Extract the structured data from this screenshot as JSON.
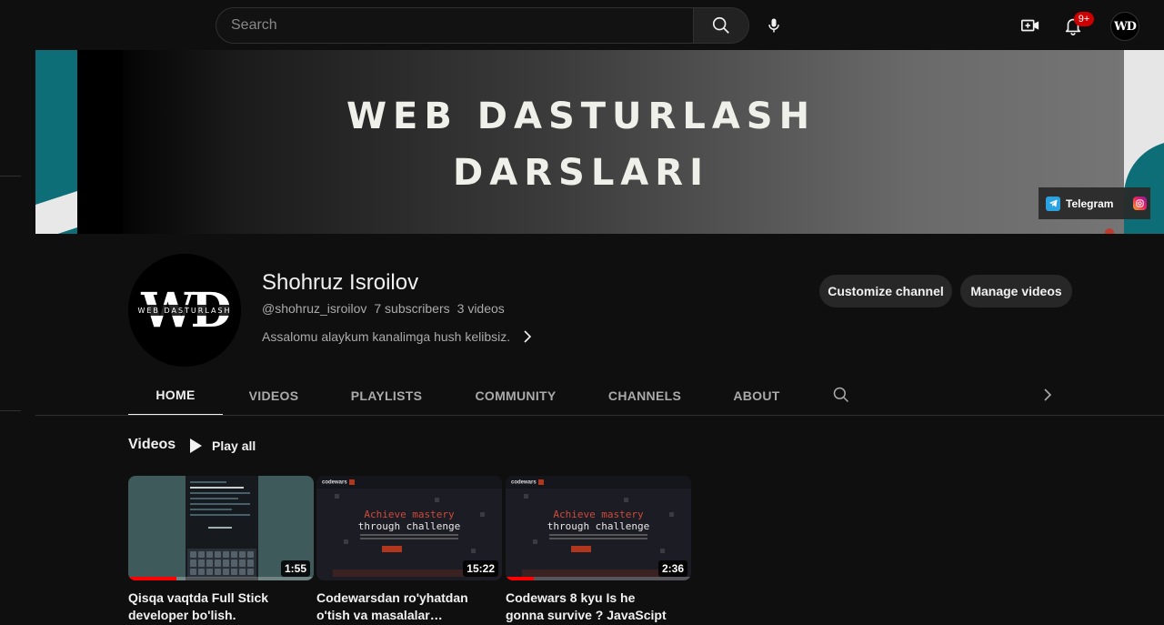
{
  "topbar": {
    "search_placeholder": "Search",
    "notification_count": "9+",
    "avatar_initials": "WD",
    "icons": [
      "search-icon",
      "mic-icon",
      "create-video-icon",
      "bell-icon"
    ]
  },
  "banner": {
    "title_line1": "WEB DASTURLASH",
    "title_line2": "DARSLARI",
    "links": [
      {
        "label": "Telegram",
        "icon": "telegram-icon"
      },
      {
        "label": "",
        "icon": "instagram-icon"
      }
    ],
    "colors": {
      "teal": "#0d6e78"
    }
  },
  "channel": {
    "avatar_text": "WD",
    "avatar_subtext": "WEB DASTURLASH",
    "name": "Shohruz Isroilov",
    "handle": "@shohruz_isroilov",
    "subscribers": "7 subscribers",
    "videos_count": "3 videos",
    "description": "Assalomu alaykum kanalimga hush kelibsiz.",
    "customize_label": "Customize channel",
    "manage_label": "Manage videos"
  },
  "tabs": [
    {
      "label": "HOME",
      "active": true
    },
    {
      "label": "VIDEOS",
      "active": false
    },
    {
      "label": "PLAYLISTS",
      "active": false
    },
    {
      "label": "COMMUNITY",
      "active": false
    },
    {
      "label": "CHANNELS",
      "active": false
    },
    {
      "label": "ABOUT",
      "active": false
    }
  ],
  "shelf": {
    "title": "Videos",
    "play_all_label": "Play all"
  },
  "videos": [
    {
      "title": "Qisqa vaqtda Full Stick developer bo'lish.",
      "duration": "1:55",
      "watched_fraction": 0.26,
      "thumb_label": "@shohcoding"
    },
    {
      "title": "Codewarsdan ro'yhatdan o'tish va masalalar ishlash...",
      "duration": "15:22",
      "watched_fraction": 0.0,
      "thumb_label": "codewars",
      "thumb_h1": "Achieve mastery",
      "thumb_h2": "through challenge"
    },
    {
      "title": "Codewars 8 kyu Is he gonna survive ? JavaScipt",
      "duration": "2:36",
      "watched_fraction": 0.15,
      "thumb_label": "codewars",
      "thumb_h1": "Achieve mastery",
      "thumb_h2": "through challenge"
    }
  ],
  "colors": {
    "accent_red": "#ff0000",
    "background": "#0f0f0f",
    "pill": "#272727"
  }
}
